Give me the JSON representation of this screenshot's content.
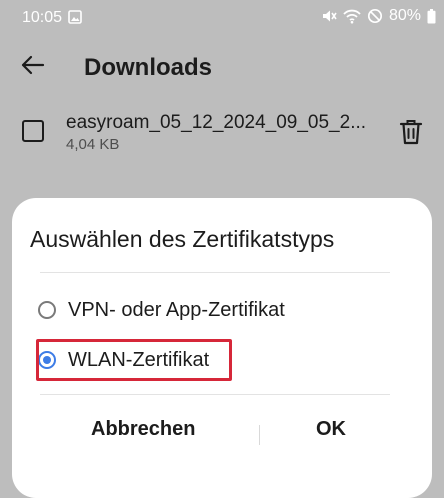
{
  "status_bar": {
    "time": "10:05",
    "battery": "80%",
    "icons": [
      "image-icon",
      "mute-icon",
      "wifi-icon",
      "do-not-disturb-icon",
      "battery-icon"
    ]
  },
  "app_bar": {
    "title": "Downloads",
    "back_icon": "arrow-left-icon"
  },
  "file": {
    "name": "easyroam_05_12_2024_09_05_2...",
    "size": "4,04 KB",
    "delete_icon": "trash-icon"
  },
  "dialog": {
    "title": "Auswählen des Zertifikatstyps",
    "options": [
      {
        "label": "VPN- oder App-Zertifikat",
        "selected": false
      },
      {
        "label": "WLAN-Zertifikat",
        "selected": true
      }
    ],
    "cancel_label": "Abbrechen",
    "ok_label": "OK"
  },
  "colors": {
    "accent": "#3d7ce6",
    "highlight": "#d62739",
    "scrim": "#bdbdbd"
  }
}
